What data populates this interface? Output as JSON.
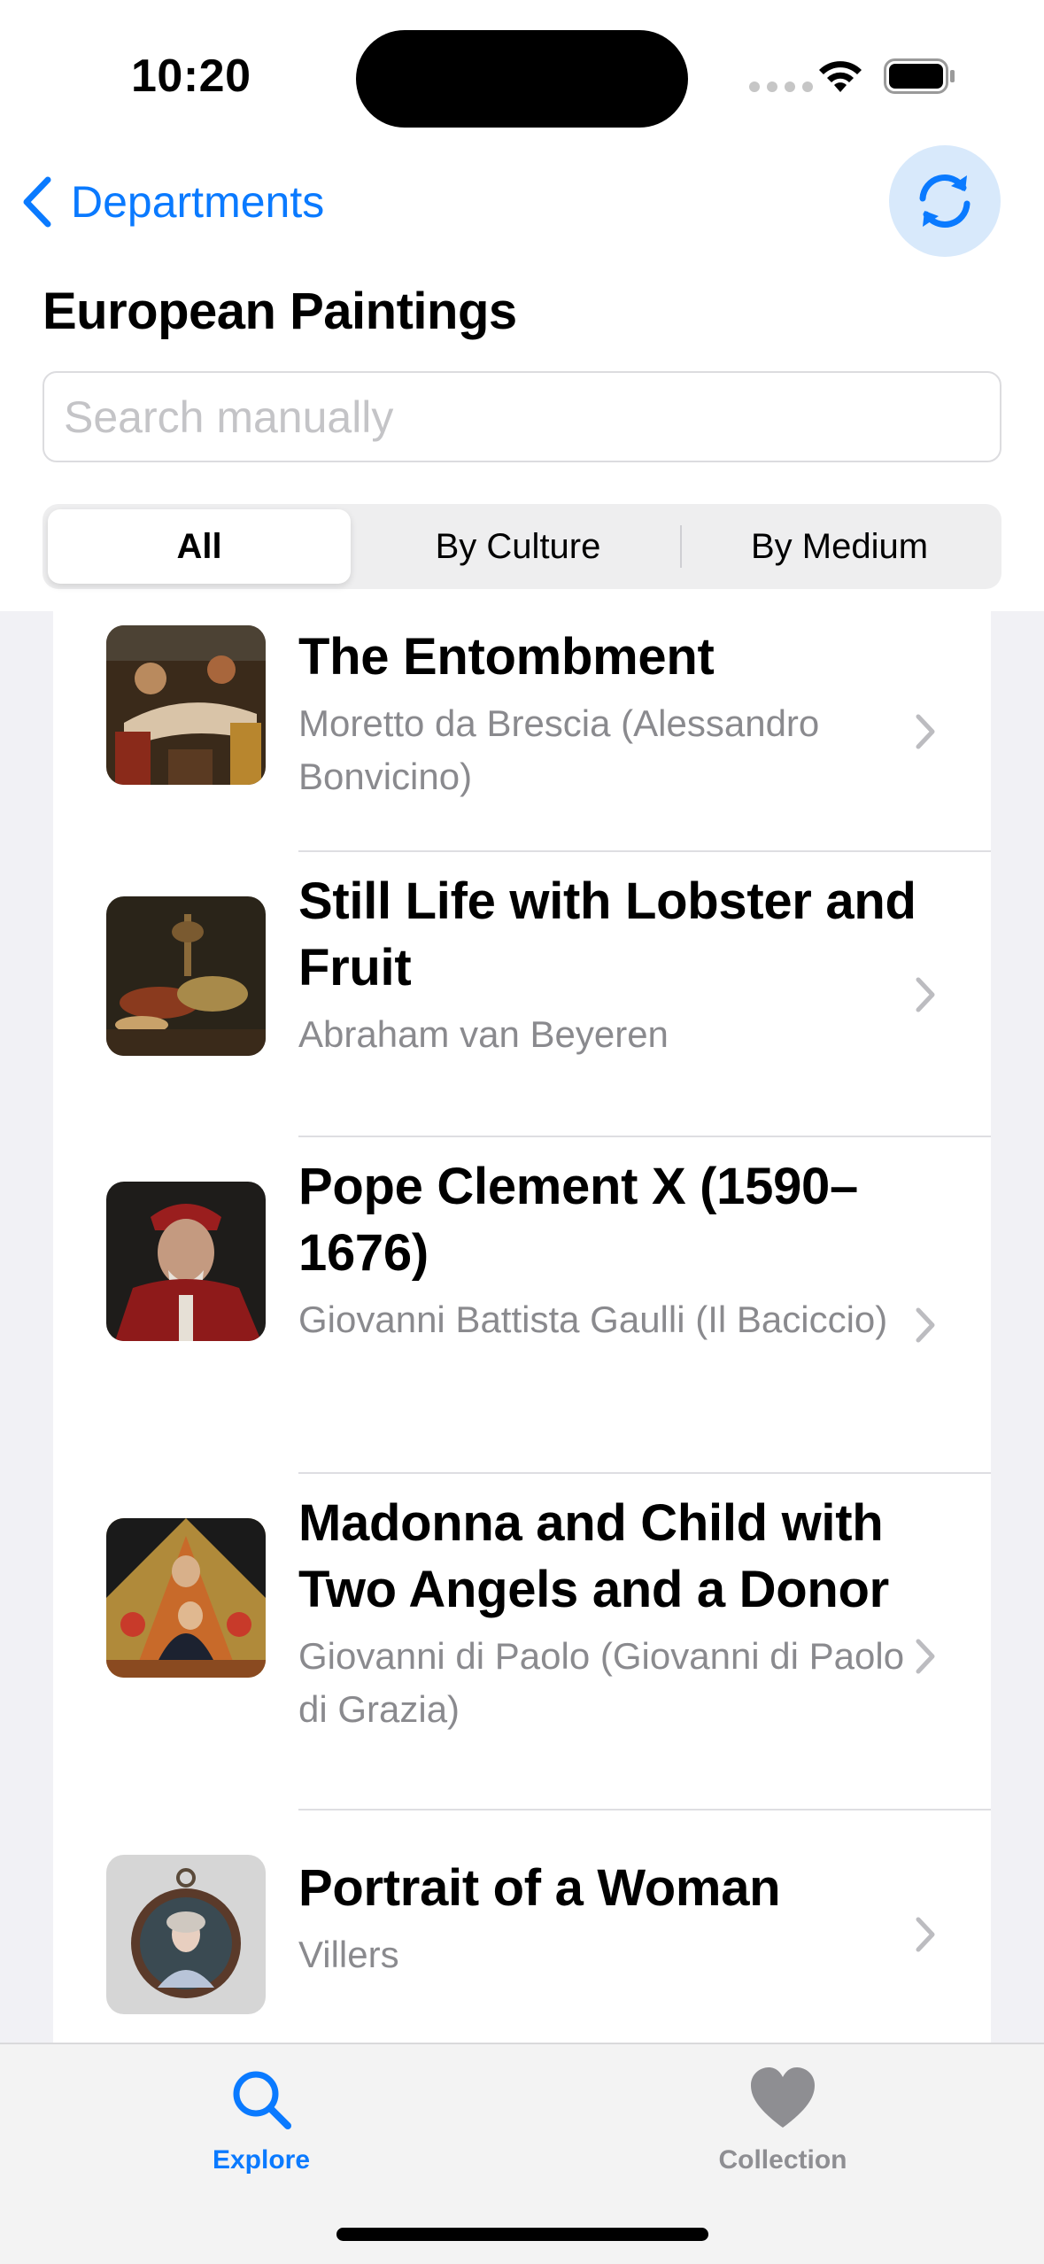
{
  "status_bar": {
    "time": "10:20"
  },
  "nav": {
    "back_label": "Departments"
  },
  "page": {
    "title": "European Paintings"
  },
  "search": {
    "placeholder": "Search manually",
    "value": ""
  },
  "segments": {
    "all": "All",
    "culture": "By Culture",
    "medium": "By Medium",
    "selected": "All"
  },
  "items": [
    {
      "title": "The Entombment",
      "artist": "Moretto da Brescia (Alessandro Bonvicino)"
    },
    {
      "title": "Still Life with Lobster and Fruit",
      "artist": "Abraham van Beyeren"
    },
    {
      "title": "Pope Clement X (1590–1676)",
      "artist": "Giovanni Battista Gaulli (Il Baciccio)"
    },
    {
      "title": "Madonna and Child with Two Angels and a Donor",
      "artist": "Giovanni di Paolo (Giovanni di Paolo di Grazia)"
    },
    {
      "title": "Portrait of a Woman",
      "artist": "Villers"
    }
  ],
  "tabs": {
    "explore": "Explore",
    "collection": "Collection",
    "active": "Explore"
  },
  "colors": {
    "accent": "#0a7aff",
    "secondary_text": "#8a8a8e",
    "list_background": "#f1f1f5"
  },
  "icons": {
    "back": "chevron-left-icon",
    "refresh": "arrow-clockwise-icon",
    "row_disclosure": "chevron-right-icon",
    "explore": "magnifying-glass-icon",
    "collection": "heart-icon"
  }
}
